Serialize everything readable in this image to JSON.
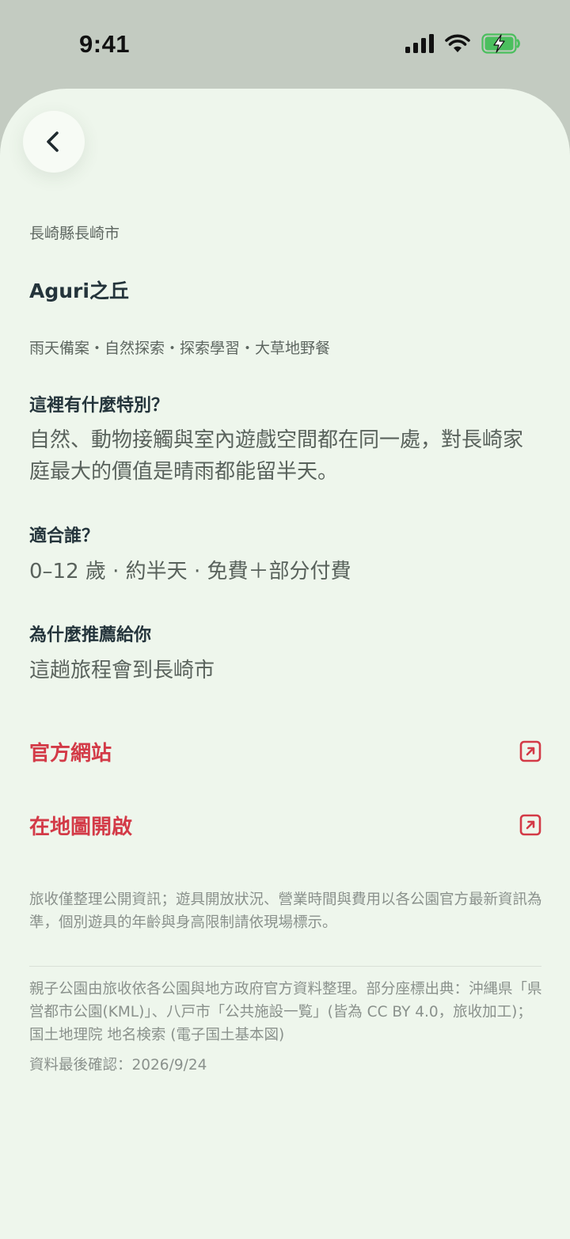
{
  "status_bar": {
    "time": "9:41"
  },
  "header": {
    "back_icon": "chevron-left-icon"
  },
  "place": {
    "location": "長崎縣長崎市",
    "name": "Aguri之丘",
    "tags": "雨天備案・自然探索・探索學習・大草地野餐"
  },
  "sections": {
    "special": {
      "heading": "這裡有什麼特別？",
      "body": "自然、動物接觸與室內遊戲空間都在同一處，對長崎家庭最大的價值是晴雨都能留半天。"
    },
    "suitable": {
      "heading": "適合誰？",
      "body": "0–12 歲 · 約半天 · 免費＋部分付費"
    },
    "recommend": {
      "heading": "為什麼推薦給你",
      "body": "這趟旅程會到長崎市"
    }
  },
  "links": {
    "website": {
      "label": "官方網站",
      "icon": "external-link-icon"
    },
    "map": {
      "label": "在地圖開啟",
      "icon": "external-link-icon"
    }
  },
  "footer": {
    "disclaimer": "旅收僅整理公開資訊；遊具開放狀況、營業時間與費用以各公園官方最新資訊為準，個別遊具的年齡與身高限制請依現場標示。",
    "sources": "親子公園由旅收依各公園與地方政府官方資料整理。部分座標出典：沖縄県「県営都市公園(KML)」、八戸市「公共施設一覧」(皆為 CC BY 4.0，旅收加工)；国土地理院 地名検索 (電子国土基本図)",
    "last_checked": "資料最後確認：2026/9/24"
  },
  "colors": {
    "background": "#eef6ec",
    "accent": "#d33a47",
    "heading": "#24343b",
    "body": "#59625c",
    "muted": "#8a918c"
  }
}
